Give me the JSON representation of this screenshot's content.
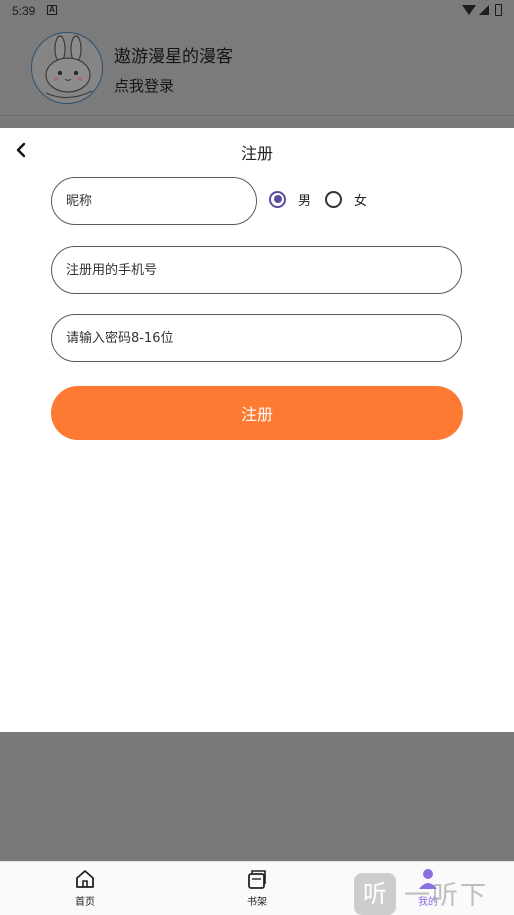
{
  "status_bar": {
    "time": "5:39",
    "notification_icon": "a-icon",
    "icons": [
      "wifi-icon",
      "signal-icon",
      "battery-icon"
    ]
  },
  "profile": {
    "nickname": "遨游漫星的漫客",
    "login_prompt": "点我登录",
    "avatar": "bunny-avatar"
  },
  "register_dialog": {
    "back_icon": "chevron-left-icon",
    "title": "注册",
    "nickname_placeholder": "昵称",
    "gender": {
      "selected": "男",
      "options": [
        "男",
        "女"
      ]
    },
    "phone_placeholder": "注册用的手机号",
    "password_placeholder": "请输入密码8-16位",
    "submit_label": "注册"
  },
  "tab_bar": {
    "items": [
      {
        "label": "首页",
        "icon": "home-icon"
      },
      {
        "label": "书架",
        "icon": "bookshelf-icon"
      },
      {
        "label": "我的",
        "icon": "user-icon",
        "active": true
      }
    ]
  },
  "watermark": {
    "badge": "听",
    "text": "一听下载"
  },
  "colors": {
    "accent": "#fe7931",
    "radio_selected": "#5b4c9e",
    "active_tab": "#8a6fe0",
    "overlay": "#7a7a7a"
  }
}
